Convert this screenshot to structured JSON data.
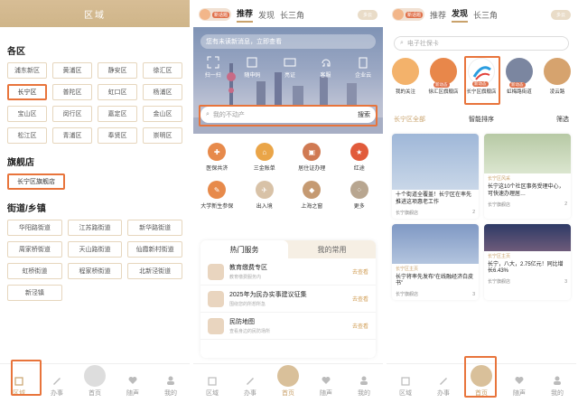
{
  "accent": "#e8743b",
  "gold": "#c9a26b",
  "p1": {
    "header_title": "区域",
    "sections": {
      "districts_title": "各区",
      "districts": [
        "浦东新区",
        "黄浦区",
        "静安区",
        "徐汇区",
        "长宁区",
        "普陀区",
        "虹口区",
        "杨浦区",
        "宝山区",
        "闵行区",
        "嘉定区",
        "金山区",
        "松江区",
        "青浦区",
        "奉贤区",
        "崇明区"
      ],
      "flagship_title": "旗舰店",
      "flagship": "长宁区旗舰店",
      "towns_title": "街道/乡镇",
      "towns": [
        "华阳路街道",
        "江苏路街道",
        "新华路街道",
        "周家桥街道",
        "天山路街道",
        "仙霞新村街道",
        "虹桥街道",
        "程家桥街道",
        "北新泾街道",
        "新泾镇"
      ]
    }
  },
  "nav": {
    "items": [
      "区域",
      "办事",
      "首页",
      "随声",
      "我的"
    ]
  },
  "p2": {
    "avatar_tag": "新话题",
    "tabs": [
      "推荐",
      "发现",
      "长三角"
    ],
    "weather": "多云",
    "search_placeholder": "您有未读新消息，立即查看",
    "quick": [
      "扫一扫",
      "随申码",
      "亮证",
      "客服",
      "企业云"
    ],
    "subsearch_placeholder": "我的不动产",
    "subsearch_btn": "搜索",
    "services": [
      "医保共济",
      "三金账单",
      "居住证办理",
      "红途",
      "大学新生参保",
      "出入境",
      "上海之窗",
      "更多"
    ],
    "hot_tabs": [
      "热门服务",
      "我的常用"
    ],
    "hot_items": [
      {
        "title": "教育缴费专区",
        "sub": "教育缴费服务内",
        "go": "去查看"
      },
      {
        "title": "2025年为民办实事建议征集",
        "sub": "围绕您的所想所急",
        "go": "去查看"
      },
      {
        "title": "民防地图",
        "sub": "查看身边的民防场所",
        "go": "去查看"
      }
    ]
  },
  "p3": {
    "avatar_tag": "新话题",
    "tabs": [
      "推荐",
      "发现",
      "长三角"
    ],
    "weather": "多云",
    "search_placeholder": "电子社保卡",
    "circles": [
      {
        "label": "我的关注",
        "tag": ""
      },
      {
        "label": "徐汇区旗舰店",
        "tag": "新动态"
      },
      {
        "label": "长宁区旗舰店",
        "tag": "新动态"
      },
      {
        "label": "虹梅路街道",
        "tag": "新动态"
      },
      {
        "label": "凌云路",
        "tag": ""
      }
    ],
    "filters": [
      "长宁区全部",
      "智能排序",
      "筛选"
    ],
    "cards": [
      {
        "text": "十个街道全覆盖！长宁区在率先推进这项惠老工作",
        "src": "长宁旗舰店",
        "cnt": "2"
      },
      {
        "pill": "长宁区风采",
        "text": "长宁这10个社区事务受理中心，可快速办理居…",
        "src": "长宁旗舰店",
        "cnt": "2"
      },
      {
        "pill": "长宁区主页",
        "text": "长宁将率先发布“在线融经济白皮书”",
        "src": "长宁旗舰店",
        "cnt": "3"
      },
      {
        "pill": "长宁区主页",
        "text": "长宁，八大，2.75亿元！同比增长6.43%",
        "src": "长宁旗舰店",
        "cnt": "3"
      }
    ]
  }
}
